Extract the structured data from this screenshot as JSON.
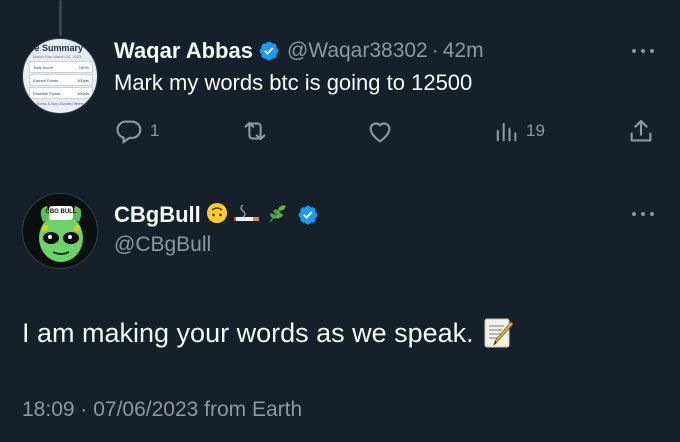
{
  "tweet1": {
    "avatar_card": {
      "title": "re Summary",
      "subtitle": "Match Run March 24, 2023",
      "rows": [
        {
          "label": "Total Score",
          "value": "100%"
        },
        {
          "label": "Earned Points",
          "value": "100pts"
        },
        {
          "label": "Possible Points",
          "value": "100pts"
        }
      ],
      "footer": "Extra & Non-Scored Items"
    },
    "display_name": "Waqar Abbas",
    "handle": "@Waqar38302",
    "separator": "·",
    "time": "42m",
    "text": "Mark my words btc is going to 12500",
    "actions": {
      "reply_count": "1",
      "retweet_count": "",
      "like_count": "",
      "views_count": "19"
    }
  },
  "tweet2": {
    "avatar_label": "CBG BULL",
    "display_name": "CBgBull",
    "name_emojis": [
      "🙃",
      "🚬",
      "🌿"
    ],
    "handle": "@CBgBull",
    "text": "I am making your words as we speak.",
    "meta": "18:09 · 07/06/2023 from Earth"
  },
  "colors": {
    "background": "#15202b",
    "text_primary": "#f7f9f9",
    "text_secondary": "#8b98a5",
    "verified": "#1d9bf0"
  }
}
